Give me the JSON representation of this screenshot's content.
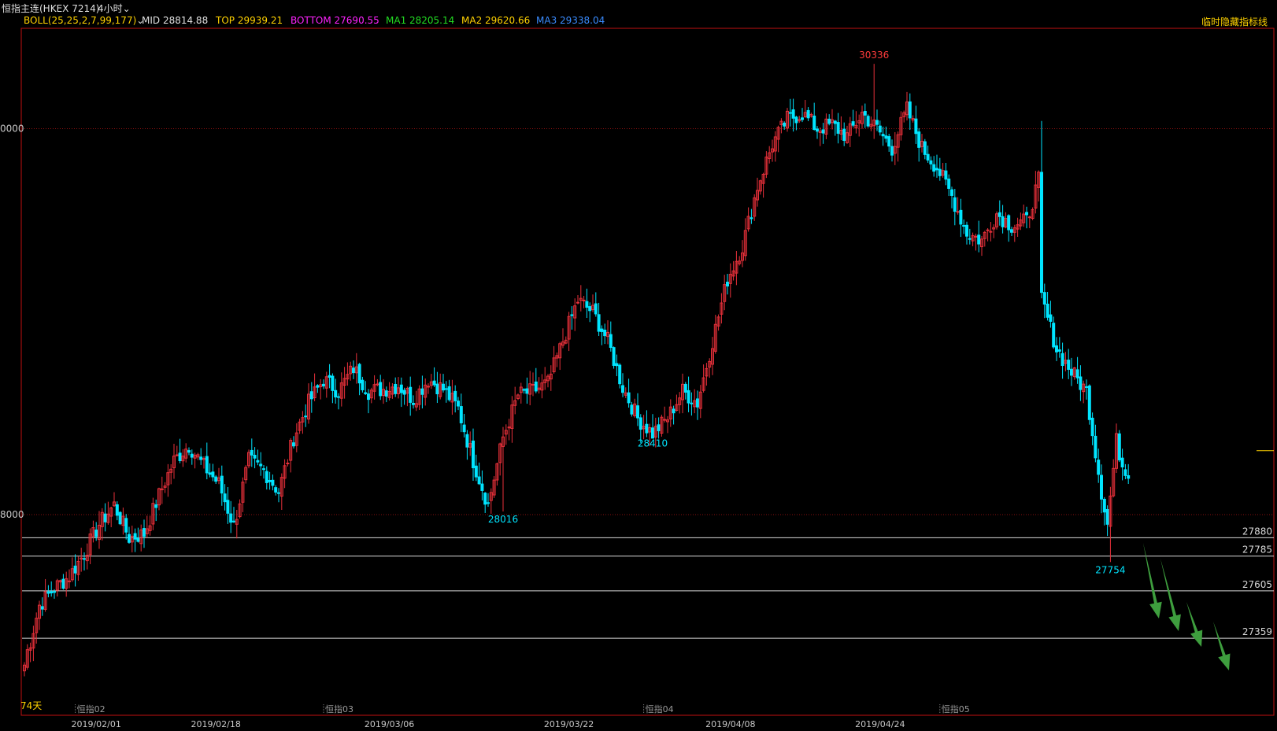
{
  "header": {
    "instrument": "恒指主连(HKEX 7214)",
    "timeframe": "4小时",
    "chevron_icon": "chevron-down-icon"
  },
  "legend": {
    "boll_label": "BOLL(25,25,2,7,99,177)",
    "mid": "MID 28814.88",
    "top": "TOP 29939.21",
    "bottom": "BOTTOM 27690.55",
    "ma1": "MA1 28205.14",
    "ma2": "MA2 29620.66",
    "ma3": "MA3 29338.04",
    "hide_indicator": "临时隐藏指标线",
    "colors": {
      "boll": "#ffd200",
      "mid": "#e0e0e0",
      "top": "#ffd200",
      "bottom": "#ff22ff",
      "ma1": "#22dd22",
      "ma2": "#ffd200",
      "ma3": "#3a8cff"
    }
  },
  "colors": {
    "up": "#e8303a",
    "down": "#00e5ff",
    "frame": "#c01010",
    "grid": "#8a1010",
    "support_line": "#d8d8d8",
    "arrow": "#3e9e3e",
    "price_label": "#d8d8d8",
    "bottom_axis": "#c8c8c8",
    "month_label": "#9a9a9a"
  },
  "chart_data": {
    "type": "candlestick",
    "title": "恒指主连(HKEX 7214) 4小时",
    "ylim": [
      26960,
      30520
    ],
    "y_gridlines": [
      30000,
      28000
    ],
    "y_axis_visible_labels": [
      "0000",
      "8000"
    ],
    "x_labels": [
      "2019/02/01",
      "2019/02/18",
      "2019/03/06",
      "2019/03/22",
      "2019/04/08",
      "2019/04/24"
    ],
    "month_markers": [
      "恒指02",
      "恒指03",
      "恒指04",
      "恒指05"
    ],
    "left_marker": "74天",
    "support_lines": [
      27880,
      27785,
      27605,
      27359
    ],
    "annotations": [
      {
        "text": "30336",
        "value": 30336,
        "type": "high",
        "color": "#ff3b3b"
      },
      {
        "text": "28016",
        "value": 28016,
        "type": "low",
        "color": "#00e5ff"
      },
      {
        "text": "28410",
        "value": 28410,
        "type": "low",
        "color": "#00e5ff"
      },
      {
        "text": "27754",
        "value": 27754,
        "type": "low",
        "color": "#00e5ff"
      }
    ],
    "anchors": [
      [
        0,
        27220
      ],
      [
        5,
        27530
      ],
      [
        10,
        27620
      ],
      [
        15,
        27680
      ],
      [
        20,
        27800
      ],
      [
        25,
        27950
      ],
      [
        30,
        28050
      ],
      [
        35,
        27880
      ],
      [
        40,
        27900
      ],
      [
        45,
        28100
      ],
      [
        50,
        28280
      ],
      [
        55,
        28360
      ],
      [
        60,
        28250
      ],
      [
        65,
        28160
      ],
      [
        70,
        27940
      ],
      [
        75,
        28280
      ],
      [
        80,
        28230
      ],
      [
        85,
        28120
      ],
      [
        90,
        28400
      ],
      [
        95,
        28580
      ],
      [
        100,
        28700
      ],
      [
        105,
        28640
      ],
      [
        110,
        28760
      ],
      [
        115,
        28640
      ],
      [
        120,
        28650
      ],
      [
        125,
        28670
      ],
      [
        130,
        28600
      ],
      [
        135,
        28700
      ],
      [
        140,
        28650
      ],
      [
        145,
        28550
      ],
      [
        150,
        28280
      ],
      [
        155,
        28050
      ],
      [
        160,
        28400
      ],
      [
        165,
        28620
      ],
      [
        170,
        28640
      ],
      [
        175,
        28680
      ],
      [
        180,
        28900
      ],
      [
        185,
        29110
      ],
      [
        190,
        29050
      ],
      [
        195,
        28900
      ],
      [
        200,
        28660
      ],
      [
        205,
        28500
      ],
      [
        210,
        28420
      ],
      [
        215,
        28500
      ],
      [
        220,
        28640
      ],
      [
        225,
        28580
      ],
      [
        230,
        28900
      ],
      [
        235,
        29220
      ],
      [
        240,
        29390
      ],
      [
        245,
        29700
      ],
      [
        250,
        29920
      ],
      [
        255,
        30050
      ],
      [
        260,
        30080
      ],
      [
        265,
        30000
      ],
      [
        270,
        30020
      ],
      [
        275,
        29960
      ],
      [
        280,
        30080
      ],
      [
        285,
        30000
      ],
      [
        290,
        29900
      ],
      [
        295,
        30100
      ],
      [
        300,
        29900
      ],
      [
        305,
        29800
      ],
      [
        310,
        29650
      ],
      [
        315,
        29460
      ],
      [
        320,
        29420
      ],
      [
        325,
        29560
      ],
      [
        330,
        29500
      ],
      [
        335,
        29520
      ],
      [
        339,
        29730
      ],
      [
        340,
        29120
      ],
      [
        345,
        28860
      ],
      [
        350,
        28740
      ],
      [
        355,
        28640
      ],
      [
        360,
        28120
      ],
      [
        362,
        27950
      ],
      [
        365,
        28380
      ],
      [
        367,
        28260
      ],
      [
        369,
        28220
      ]
    ],
    "candle_count": 370
  },
  "forecast_arrows": [
    {
      "name": "down-arrow-1"
    },
    {
      "name": "down-arrow-2"
    },
    {
      "name": "down-arrow-3"
    },
    {
      "name": "down-arrow-4"
    }
  ]
}
